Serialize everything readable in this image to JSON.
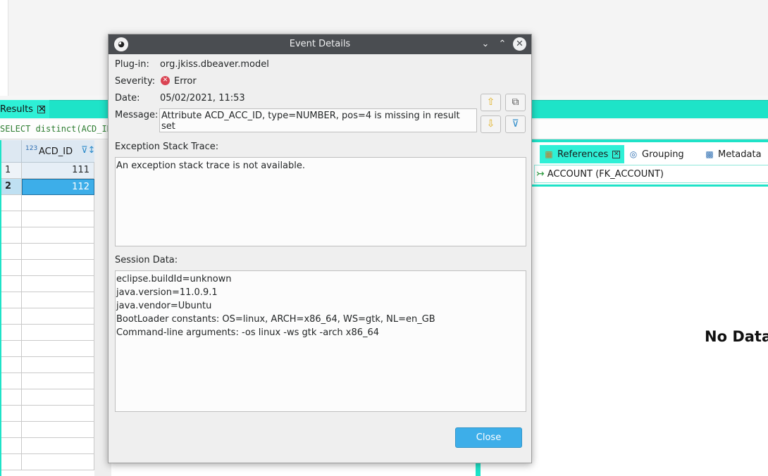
{
  "background": {
    "results_tab_label": "Results",
    "sql_text": "SELECT distinct(ACD_ID) F",
    "column_type_badge": "123",
    "column_name": "ACD_ID",
    "rows": [
      {
        "num": "1",
        "value": "111"
      },
      {
        "num": "2",
        "value": "112"
      }
    ],
    "panel_tabs": {
      "references": "References",
      "grouping": "Grouping",
      "metadata": "Metadata"
    },
    "reference_item": "ACCOUNT (FK_ACCOUNT)",
    "no_data_text": "No Data"
  },
  "dialog": {
    "title": "Event Details",
    "fields": {
      "plugin_label": "Plug-in:",
      "plugin_value": "org.jkiss.dbeaver.model",
      "severity_label": "Severity:",
      "severity_value": "Error",
      "date_label": "Date:",
      "date_value": "05/02/2021, 11:53",
      "message_label": "Message:",
      "message_value": "Attribute ACD_ACC_ID, type=NUMBER, pos=4 is missing in result set"
    },
    "stack_trace_label": "Exception Stack Trace:",
    "stack_trace_text": "An exception stack trace is not available.",
    "session_label": "Session Data:",
    "session_lines": [
      "eclipse.buildId=unknown",
      "java.version=11.0.9.1",
      "java.vendor=Ubuntu",
      "BootLoader constants: OS=linux, ARCH=x86_64, WS=gtk, NL=en_GB",
      "Command-line arguments:  -os linux -ws gtk -arch x86_64"
    ],
    "close_label": "Close"
  },
  "colors": {
    "accent_teal": "#1ee3c8",
    "titlebar": "#4a4d51",
    "primary_button": "#3daee9",
    "error": "#da4453"
  }
}
